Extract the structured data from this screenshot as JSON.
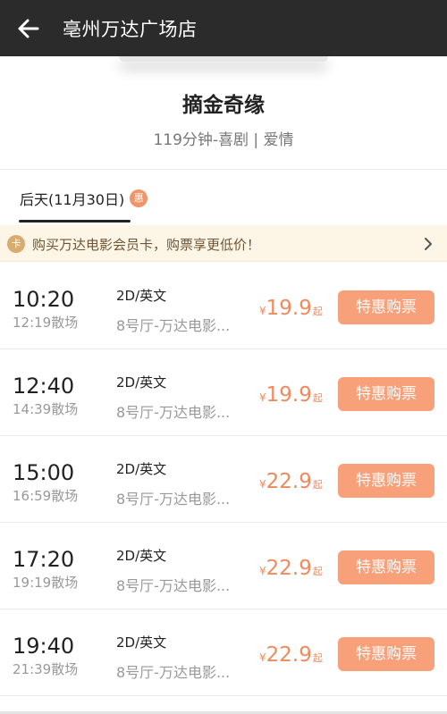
{
  "header": {
    "title": "亳州万达广场店"
  },
  "movie": {
    "name": "摘金奇缘",
    "meta": "119分钟-喜剧 | 爱情"
  },
  "date_tab": {
    "label": "后天(11月30日)",
    "badge": "惠"
  },
  "promo": {
    "icon_text": "卡",
    "text": "购买万达电影会员卡，购票享更低价！"
  },
  "showtimes": [
    {
      "start": "10:20",
      "end": "12:19散场",
      "format": "2D/英文",
      "hall": "8号厅-万达电影...",
      "currency": "¥",
      "price": "19.9",
      "suffix": "起",
      "button": "特惠购票"
    },
    {
      "start": "12:40",
      "end": "14:39散场",
      "format": "2D/英文",
      "hall": "8号厅-万达电影...",
      "currency": "¥",
      "price": "19.9",
      "suffix": "起",
      "button": "特惠购票"
    },
    {
      "start": "15:00",
      "end": "16:59散场",
      "format": "2D/英文",
      "hall": "8号厅-万达电影...",
      "currency": "¥",
      "price": "22.9",
      "suffix": "起",
      "button": "特惠购票"
    },
    {
      "start": "17:20",
      "end": "19:19散场",
      "format": "2D/英文",
      "hall": "8号厅-万达电影...",
      "currency": "¥",
      "price": "22.9",
      "suffix": "起",
      "button": "特惠购票"
    },
    {
      "start": "19:40",
      "end": "21:39散场",
      "format": "2D/英文",
      "hall": "8号厅-万达电影...",
      "currency": "¥",
      "price": "22.9",
      "suffix": "起",
      "button": "特惠购票"
    }
  ],
  "colors": {
    "topbar": "#2b2b2b",
    "accent": "#f08a5d",
    "button": "#f7a07a",
    "promo_bg": "#fdf6e6"
  },
  "icons": {
    "back": "arrow-left-icon",
    "chevron": "chevron-right-icon"
  }
}
